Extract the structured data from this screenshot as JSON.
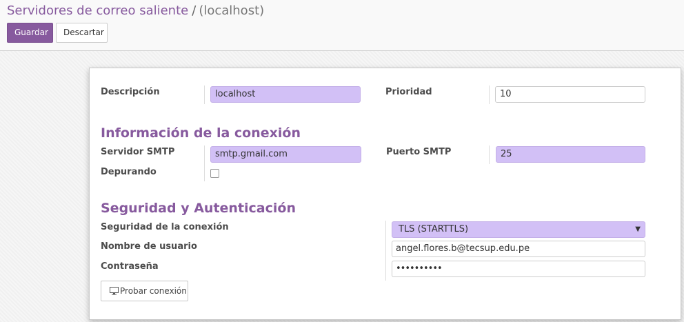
{
  "breadcrumb": {
    "parent": "Servidores de correo saliente",
    "separator": "/",
    "current": "(localhost)"
  },
  "toolbar": {
    "save_label": "Guardar",
    "discard_label": "Descartar"
  },
  "form": {
    "description": {
      "label": "Descripción",
      "value": "localhost"
    },
    "priority": {
      "label": "Prioridad",
      "value": "10"
    },
    "connection_section": "Información de la conexión",
    "smtp_server": {
      "label": "Servidor SMTP",
      "value": "smtp.gmail.com"
    },
    "smtp_port": {
      "label": "Puerto SMTP",
      "value": "25"
    },
    "debugging": {
      "label": "Depurando",
      "checked": false
    },
    "security_section": "Seguridad y Autenticación",
    "connection_security": {
      "label": "Seguridad de la conexión",
      "value": "TLS (STARTTLS)"
    },
    "username": {
      "label": "Nombre de usuario",
      "value": "angel.flores.b@tecsup.edu.pe"
    },
    "password": {
      "label": "Contraseña",
      "value": "••••••••••"
    },
    "test_button": "Probar conexión"
  },
  "colors": {
    "accent": "#875a9e",
    "required_field": "#d2c0f6"
  },
  "icons": {
    "test_button_icon": "monitor-icon",
    "select_icon": "caret-down-icon"
  }
}
